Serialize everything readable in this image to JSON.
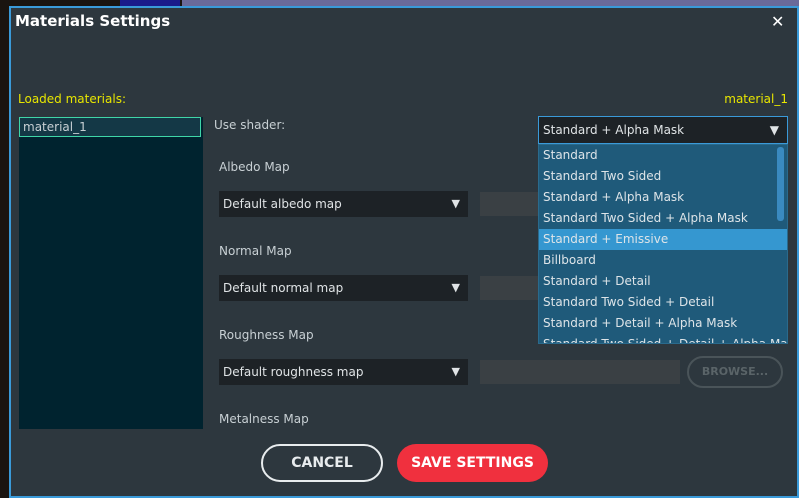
{
  "dialog": {
    "title": "Materials Settings",
    "close": "✕"
  },
  "loaded_label": "Loaded materials:",
  "current_material": "material_1",
  "materials": [
    "material_1"
  ],
  "shader": {
    "label": "Use shader:",
    "value": "Standard + Alpha Mask",
    "options": [
      "Standard",
      "Standard Two Sided",
      "Standard + Alpha Mask",
      "Standard Two Sided + Alpha Mask",
      "Standard + Emissive",
      "Billboard",
      "Standard + Detail",
      "Standard Two Sided + Detail",
      "Standard + Detail + Alpha Mask",
      "Standard Two Sided + Detail + Alpha Mask"
    ],
    "highlighted": "Standard + Emissive"
  },
  "maps": [
    {
      "label": "Albedo Map",
      "value": "Default albedo map"
    },
    {
      "label": "Normal Map",
      "value": "Default normal map"
    },
    {
      "label": "Roughness Map",
      "value": "Default roughness map",
      "browse": "BROWSE..."
    },
    {
      "label": "Metalness Map"
    }
  ],
  "buttons": {
    "cancel": "CANCEL",
    "save": "SAVE SETTINGS"
  },
  "colors": {
    "accent": "#3a9ad9",
    "save": "#f0303e",
    "label": "#e8e600",
    "selection": "#3fd6a8"
  }
}
